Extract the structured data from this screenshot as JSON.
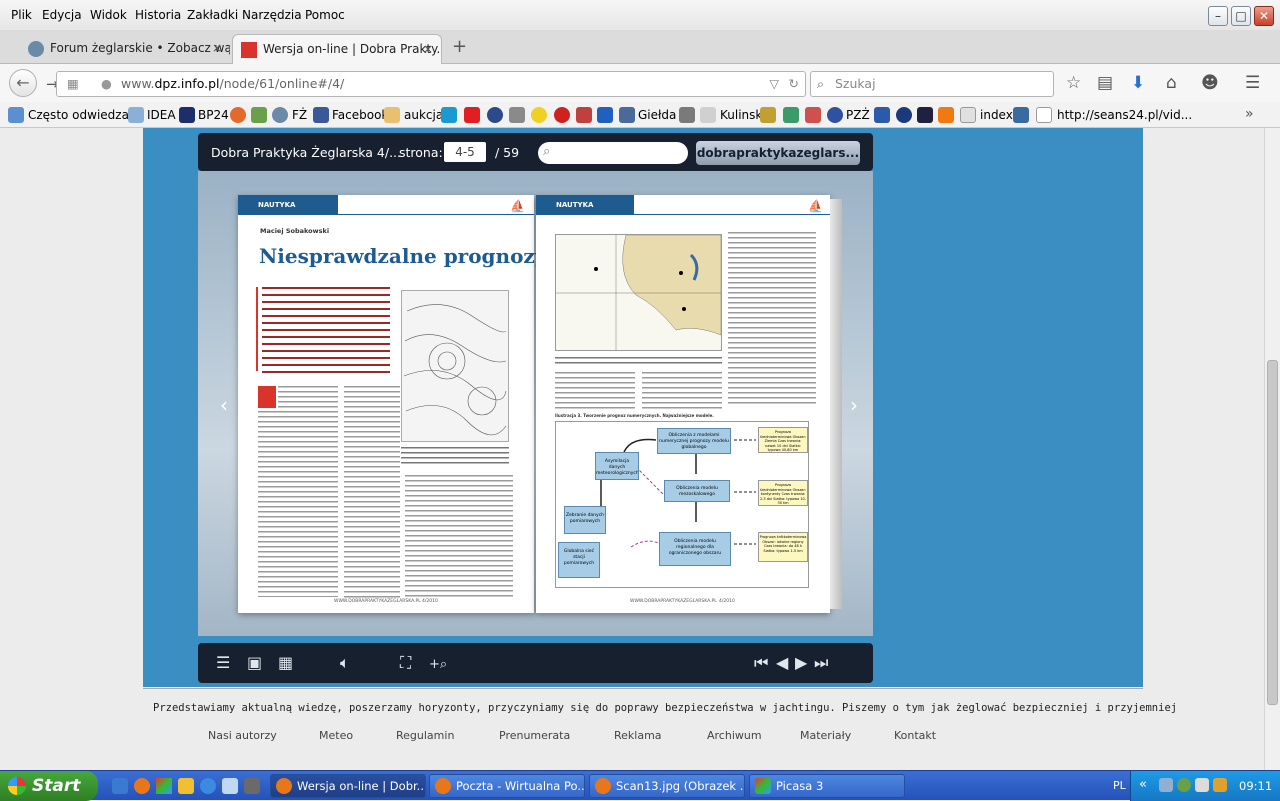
{
  "menu": [
    "Plik",
    "Edycja",
    "Widok",
    "Historia",
    "Zakładki",
    "Narzędzia",
    "Pomoc"
  ],
  "tabs": [
    {
      "title": "Forum żeglarskie • Zobacz wą...",
      "close": "×"
    },
    {
      "title": "Wersja on-line | Dobra Prakty...",
      "close": "×"
    }
  ],
  "new_tab": "+",
  "url": {
    "prefix": "www.",
    "domain": "dpz.info.pl",
    "path": "/node/61/online#/4/"
  },
  "search_placeholder": "Szukaj",
  "bookmarks": [
    "Często odwiedzane",
    "IDEA",
    "BP24",
    "FŻ",
    "Facebook",
    "aukcja",
    "Giełda",
    "Kulinski",
    "PZŻ",
    "index",
    "http://seans24.pl/vid..."
  ],
  "viewer": {
    "title": "Dobra Praktyka Żeglarska 4/...",
    "page_label": "strona:",
    "page_value": "4-5",
    "page_total": "/ 59",
    "site_button": "dobrapraktykazeglars..."
  },
  "left_page": {
    "section": "NAUTYKA",
    "author": "Maciej Sobakowski",
    "headline": "Niesprawdzalne prognozy",
    "footer": "WWW.DOBRAPRAKTYKAZEGLARSKA.PL",
    "issue": "4/2010"
  },
  "right_page": {
    "section": "NAUTYKA",
    "diagram_caption": "Ilustracja 3. Tworzenie prognoz numerycznych. Najważniejsze modele.",
    "diagram_nodes": [
      "Obliczenia z modelami numerycznej prognozy modelu globalnego",
      "Prognoza średnioterminowa Obszar: Ziemia Czas trwania: nawet 10 dni Siatka: typowo 40-80 km",
      "Asymilacja danych meteorologicznych",
      "Obliczenia modelu mezoskalowego",
      "Prognoza średnioterminowa Obszar: kontynenty Czas trwania: 2-3 dni Siatka: typowo 10-30 km",
      "Zebranie danych pomiarowych",
      "Globalna sieć stacji pomiarowych",
      "Obliczenia modelu regionalnego dla ograniczonego obszaru",
      "Prognoza krótkoterminowa Obszar: lokalne regiony Czas trwania: do 48 h Siatka: typowo 1-5 km"
    ],
    "footer": "WWW.DOBRAPRAKTYKAZEGLARSKA.PL",
    "issue": "4/2010"
  },
  "footer": {
    "tagline": "Przedstawiamy aktualną wiedzę, poszerzamy horyzonty, przyczyniamy się do poprawy bezpieczeństwa w jachtingu. Piszemy o tym jak żeglować bezpieczniej i przyjemniej",
    "links": [
      "Nasi autorzy",
      "Meteo",
      "Regulamin",
      "Prenumerata",
      "Reklama",
      "Archiwum",
      "Materiały",
      "Kontakt"
    ]
  },
  "taskbar": {
    "start": "Start",
    "tasks": [
      "Wersja on-line | Dobr...",
      "Poczta - Wirtualna Po...",
      "Scan13.jpg (Obrazek ...",
      "Picasa 3"
    ],
    "lang": "PL",
    "clock": "09:11"
  }
}
